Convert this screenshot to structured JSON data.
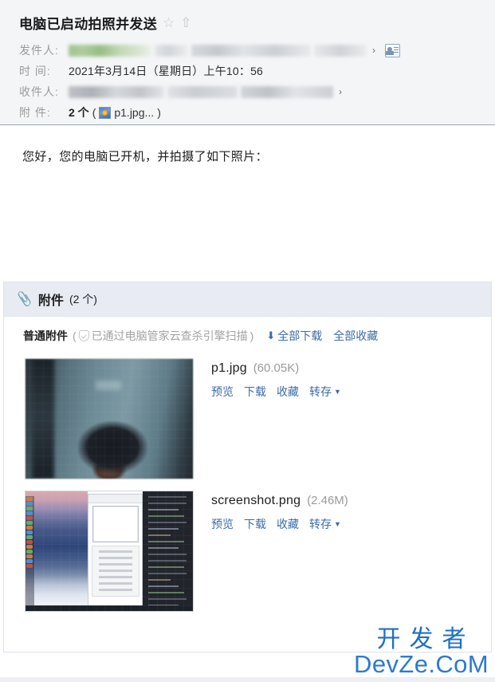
{
  "header": {
    "subject": "电脑已启动拍照并发送",
    "star_icon": "star-icon",
    "flag_icon": "up-arrow-icon",
    "sender": {
      "label": "发件人:",
      "value_redacted": true
    },
    "time": {
      "label": "时  间:",
      "value": "2021年3月14日（星期日）上午10：56"
    },
    "recipient": {
      "label": "收件人:",
      "value_redacted": true
    },
    "attachment": {
      "label": "附  件:",
      "count_text": "2 个",
      "paren_open": "(",
      "first_file": "p1.jpg...",
      "paren_close": ")"
    },
    "contact_card_icon": "contact-card-icon"
  },
  "body": {
    "text": "您好，您的电脑已开机，并拍摄了如下照片："
  },
  "attachments_panel": {
    "paperclip_icon": "paperclip-icon",
    "title": "附件",
    "count": "(2 个)",
    "group_label": "普通附件",
    "scan_note_open": "(",
    "scan_note": "已通过电脑管家云查杀引擎扫描",
    "scan_note_close": ")",
    "shield_icon": "shield-icon",
    "download_arrow_icon": "download-arrow-icon",
    "download_all": "全部下载",
    "favorite_all": "全部收藏",
    "items": [
      {
        "name": "p1.jpg",
        "size": "(60.05K)",
        "thumb_kind": "photo",
        "actions": [
          "预览",
          "下载",
          "收藏",
          "转存"
        ],
        "dropdown_icon": "caret-down-icon"
      },
      {
        "name": "screenshot.png",
        "size": "(2.46M)",
        "thumb_kind": "screenshot",
        "actions": [
          "预览",
          "下载",
          "收藏",
          "转存"
        ],
        "dropdown_icon": "caret-down-icon"
      }
    ]
  },
  "watermark": {
    "cn": "开发者",
    "en": "DevZe.CoM",
    "color": "#1f6fc4"
  }
}
